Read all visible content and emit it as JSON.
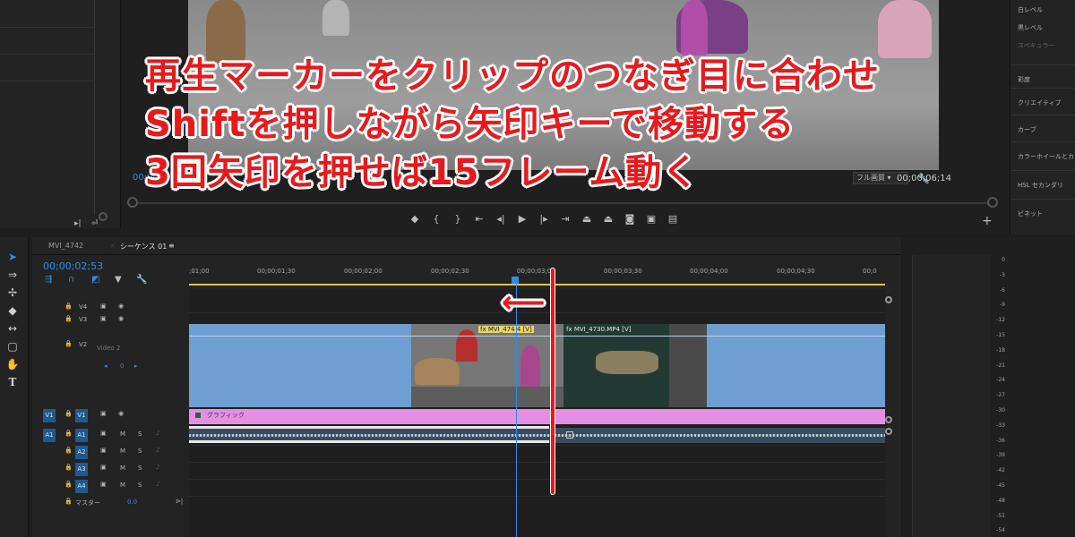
{
  "monitor": {
    "timecode_left": "00;00",
    "quality": "フル画質",
    "timecode_right": "00;00;06;14"
  },
  "lumetri": {
    "items": [
      "白レベル",
      "黒レベル",
      "スペキュラー",
      "彩度",
      "クリエイティブ",
      "カーブ",
      "カラーホイールとカ",
      "HSL セカンダリ",
      "ビネット"
    ]
  },
  "timeline": {
    "tabs": [
      "MVI_4742",
      "シーケンス 01"
    ],
    "timecode": "00;00;02;53",
    "ruler_ticks": [
      ";01;00",
      "00;00;01;30",
      "00;00;02;00",
      "00;00;02;30",
      "00;00;03;0",
      "00;00;03;30",
      "00;00;04;00",
      "00;00;04;30",
      "00;0"
    ],
    "tracks": {
      "v4": "V4",
      "v3": "V3",
      "v2": "V2",
      "v2_name": "Video 2",
      "v2_value": "0",
      "v1_src": "V1",
      "v1": "V1",
      "a1_src": "A1",
      "a1": "A1",
      "a2": "A2",
      "a3": "A3",
      "a4": "A4",
      "master": "マスター",
      "master_value": "0.0",
      "m": "M",
      "s": "S"
    },
    "clips": {
      "clip_a": "MVI_474",
      "clip_a_tail": "4 [V]",
      "clip_b": "MVI_4730.MP4 [V]",
      "graphic": "グラフィック"
    }
  },
  "meters": {
    "scale": [
      "0",
      "-3",
      "-6",
      "-9",
      "-12",
      "-15",
      "-18",
      "-21",
      "-24",
      "-27",
      "-30",
      "-33",
      "-36",
      "-39",
      "-42",
      "-45",
      "-48",
      "-51",
      "-54"
    ]
  },
  "caption": {
    "line1": "再生マーカーをクリップのつなぎ目に合わせ",
    "line2": "Shiftを押しながら矢印キーで移動する",
    "line3": "3回矢印を押せば15フレーム動く",
    "arrow": "⟵"
  },
  "colors": {
    "accent_blue": "#2d8ceb",
    "caption_red": "#e8191c",
    "v2_clip": "#6f9ed3",
    "graphic_clip": "#e48fe3"
  }
}
